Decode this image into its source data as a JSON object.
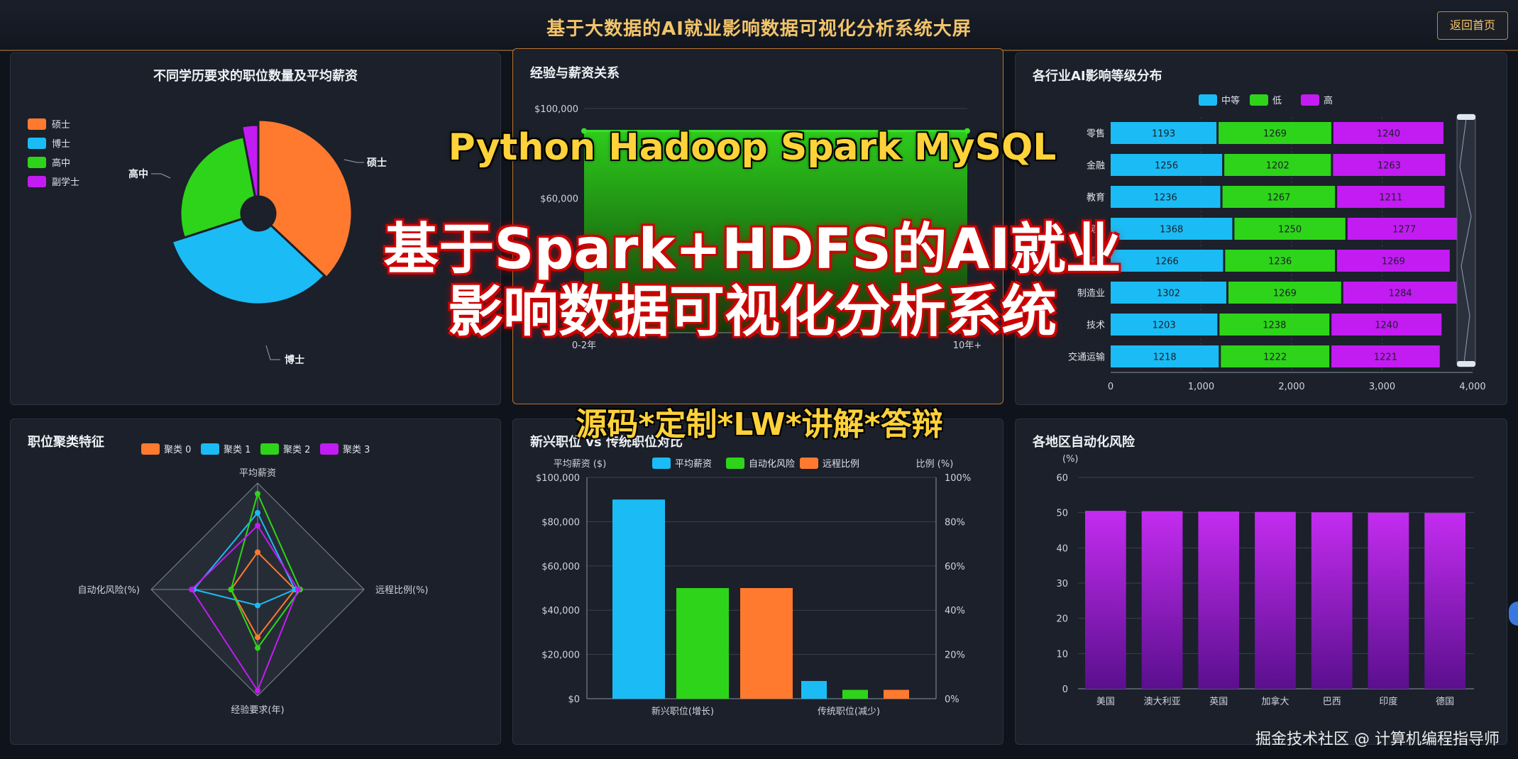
{
  "header": {
    "title": "基于大数据的AI就业影响数据可视化分析系统大屏",
    "back_label": "返回首页"
  },
  "panels": {
    "education": {
      "title": "不同学历要求的职位数量及平均薪资",
      "legend": [
        "硕士",
        "博士",
        "高中",
        "副学士"
      ],
      "colors": [
        "#ff7a2f",
        "#1bbcf5",
        "#2ed41a",
        "#c21cf2"
      ],
      "labels": [
        "硕士",
        "博士",
        "高中"
      ]
    },
    "experience": {
      "title": "经验与薪资关系",
      "yticks": [
        "$100,000",
        "$60,000"
      ],
      "xticks": [
        "0-2年",
        "10年+"
      ]
    },
    "industry": {
      "title": "各行业AI影响等级分布",
      "legend": [
        "中等",
        "低",
        "高"
      ],
      "categories": [
        "零售",
        "金融",
        "教育",
        "娱乐",
        "医疗",
        "制造业",
        "技术",
        "交通运输"
      ],
      "rows": [
        [
          1193,
          1269,
          1240
        ],
        [
          1256,
          1202,
          1263
        ],
        [
          1236,
          1267,
          1211
        ],
        [
          1368,
          1250,
          1277
        ],
        [
          1266,
          1236,
          1269
        ],
        [
          1302,
          1269,
          1284
        ],
        [
          1203,
          1238,
          1240
        ],
        [
          1218,
          1222,
          1221
        ]
      ],
      "xticks": [
        "0",
        "1,000",
        "2,000",
        "3,000",
        "4,000"
      ]
    },
    "cluster": {
      "title": "职位聚类特征",
      "legend": [
        "聚类 0",
        "聚类 1",
        "聚类 2",
        "聚类 3"
      ],
      "axes": [
        "平均薪资",
        "远程比例(%)",
        "经验要求(年)",
        "自动化风险(%)"
      ]
    },
    "compare": {
      "title": "新兴职位 vs 传统职位对比",
      "legend": [
        "平均薪资",
        "自动化风险",
        "远程比例"
      ],
      "left_axis_name": "平均薪资 ($)",
      "right_axis_name": "比例 (%)",
      "left_ticks": [
        "$100,000",
        "$80,000",
        "$60,000",
        "$40,000",
        "$20,000",
        "$0"
      ],
      "right_ticks": [
        "100%",
        "80%",
        "60%",
        "40%",
        "20%",
        "0%"
      ],
      "categories": [
        "新兴职位(增长)",
        "传统职位(减少)"
      ]
    },
    "region": {
      "title": "各地区自动化风险",
      "unit": "(%)",
      "yticks": [
        "60",
        "50",
        "40",
        "30",
        "20",
        "10",
        "0"
      ],
      "categories": [
        "美国",
        "澳大利亚",
        "英国",
        "加拿大",
        "巴西",
        "印度",
        "德国"
      ]
    }
  },
  "chart_data": [
    {
      "type": "pie",
      "title": "不同学历要求的职位数量及平均薪资",
      "categories": [
        "硕士",
        "博士",
        "高中",
        "副学士"
      ],
      "values": [
        37,
        33,
        27,
        3
      ]
    },
    {
      "type": "area",
      "title": "经验与薪资关系",
      "categories": [
        "0-2年",
        "10年+"
      ],
      "values": [
        90000,
        90000
      ],
      "ylim": [
        0,
        100000
      ]
    },
    {
      "type": "bar",
      "title": "各行业AI影响等级分布",
      "categories": [
        "零售",
        "金融",
        "教育",
        "娱乐",
        "医疗",
        "制造业",
        "技术",
        "交通运输"
      ],
      "series": [
        {
          "name": "中等",
          "values": [
            1193,
            1256,
            1236,
            1368,
            1266,
            1302,
            1203,
            1218
          ]
        },
        {
          "name": "低",
          "values": [
            1269,
            1202,
            1267,
            1250,
            1236,
            1269,
            1238,
            1222
          ]
        },
        {
          "name": "高",
          "values": [
            1240,
            1263,
            1211,
            1277,
            1269,
            1284,
            1240,
            1221
          ]
        }
      ],
      "xlim": [
        0,
        4000
      ]
    },
    {
      "type": "radar",
      "title": "职位聚类特征",
      "axes": [
        "平均薪资",
        "远程比例(%)",
        "经验要求(年)",
        "自动化风险(%)"
      ],
      "series": [
        {
          "name": "聚类 0",
          "values": [
            0.35,
            0.35,
            0.45,
            0.25
          ]
        },
        {
          "name": "聚类 1",
          "values": [
            0.72,
            0.35,
            0.15,
            0.6
          ]
        },
        {
          "name": "聚类 2",
          "values": [
            0.9,
            0.4,
            0.55,
            0.25
          ]
        },
        {
          "name": "聚类 3",
          "values": [
            0.6,
            0.38,
            0.95,
            0.62
          ]
        }
      ]
    },
    {
      "type": "bar",
      "title": "新兴职位 vs 传统职位对比",
      "categories": [
        "新兴职位(增长)",
        "传统职位(减少)"
      ],
      "series": [
        {
          "name": "平均薪资",
          "values": [
            90000,
            8000
          ]
        },
        {
          "name": "自动化风险",
          "values": [
            50,
            4
          ]
        },
        {
          "name": "远程比例",
          "values": [
            50,
            4
          ]
        }
      ],
      "ylim": [
        0,
        100000
      ],
      "y2lim": [
        0,
        100
      ]
    },
    {
      "type": "bar",
      "title": "各地区自动化风险",
      "categories": [
        "美国",
        "澳大利亚",
        "英国",
        "加拿大",
        "巴西",
        "印度",
        "德国"
      ],
      "values": [
        50.5,
        50.4,
        50.3,
        50.2,
        50.1,
        50.0,
        49.9
      ],
      "ylim": [
        0,
        60
      ],
      "ylabel": "(%)"
    }
  ],
  "overlay": {
    "tech": "Python Hadoop Spark MySQL",
    "line1": "基于Spark+HDFS的AI就业",
    "line2": "影响数据可视化分析系统",
    "sub": "源码*定制*LW*讲解*答辩"
  },
  "watermark": "掘金技术社区 @ 计算机编程指导师"
}
